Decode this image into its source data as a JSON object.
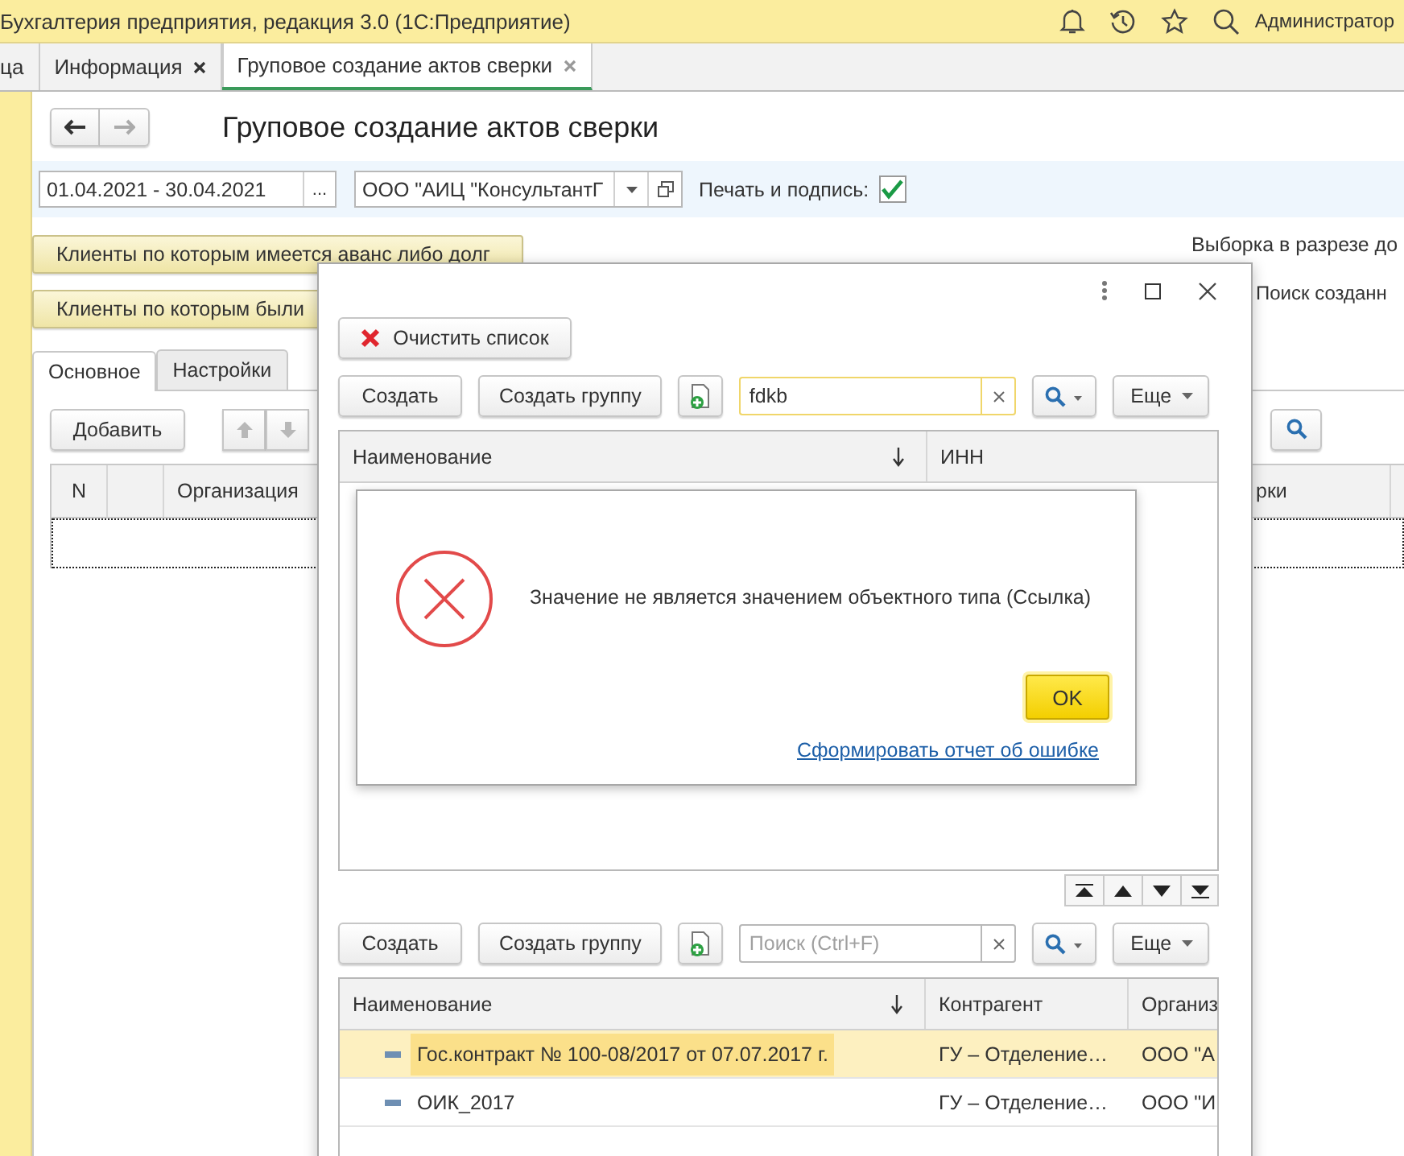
{
  "app_bar": {
    "title": "Бухгалтерия предприятия, редакция 3.0  (1С:Предприятие)",
    "user": "Администратор"
  },
  "open_tabs": [
    {
      "label": "ца",
      "closable": false,
      "selected": false
    },
    {
      "label": "Информация",
      "closable": true,
      "selected": false
    },
    {
      "label": "Груповое создание актов сверки",
      "closable": true,
      "selected": true
    }
  ],
  "form": {
    "title": "Груповое создание актов сверки",
    "period": "01.04.2021 - 30.04.2021",
    "period_button": "...",
    "organization": "ООО \"АИЦ \"КонсультантГ",
    "print_label": "Печать и подпись:",
    "print_checked": true,
    "buttons": [
      "Клиенты по которым имеется аванс либо долг",
      "Клиенты по которым были"
    ],
    "side_labels": [
      "Выборка в разрезе до",
      "Поиск созданн"
    ],
    "tabs": [
      {
        "label": "Основное",
        "selected": true
      },
      {
        "label": "Настройки",
        "selected": false
      }
    ],
    "add_button": "Добавить",
    "table": {
      "column_1": "N",
      "column_3": "Организация",
      "column_4": "рки"
    }
  },
  "dialog": {
    "clear_button": "Очистить список",
    "upper_list": {
      "create": "Создать",
      "create_group": "Создать группу",
      "search_value": "fdkb",
      "more": "Еще",
      "columns": [
        {
          "label": "Наименование",
          "sorted": true
        },
        {
          "label": "ИНН",
          "sorted": false
        }
      ]
    },
    "lower_list": {
      "create": "Создать",
      "create_group": "Создать группу",
      "search_placeholder": "Поиск (Ctrl+F)",
      "more": "Еще",
      "columns": [
        {
          "label": "Наименование",
          "sorted": true
        },
        {
          "label": "Контрагент",
          "sorted": false
        },
        {
          "label": "Организ",
          "sorted": false
        }
      ],
      "rows": [
        {
          "cells": [
            "Гос.контракт № 100-08/2017 от 07.07.2017 г.",
            "ГУ – Отделение…",
            "ООО \"А"
          ],
          "selected": true
        },
        {
          "cells": [
            "ОИК_2017",
            "ГУ – Отделение…",
            "ООО \"И"
          ],
          "selected": false
        }
      ]
    }
  },
  "error": {
    "message": "Значение не является значением объектного типа (Ссылка)",
    "ok": "OK",
    "report_link": "Сформировать отчет об ошибке"
  }
}
